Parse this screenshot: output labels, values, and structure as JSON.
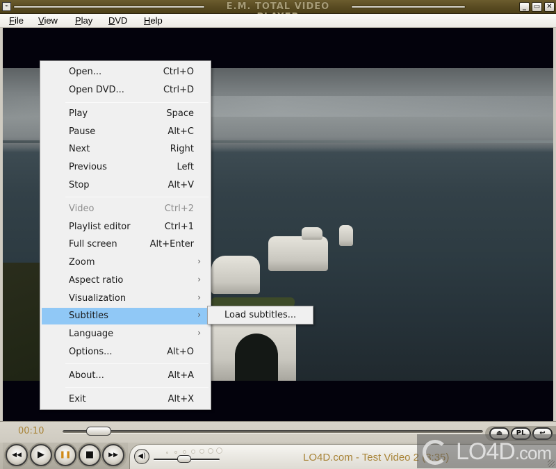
{
  "window": {
    "title": "E.M. TOTAL VIDEO PLAYER",
    "system_icon": "app-menu-icon",
    "buttons": {
      "minimize": "_",
      "maximize": "▭",
      "close": "✕"
    }
  },
  "menubar": {
    "items": [
      {
        "label": "File",
        "underline": "F",
        "rest": "ile"
      },
      {
        "label": "View",
        "underline": "V",
        "rest": "iew"
      },
      {
        "label": "Play",
        "underline": "P",
        "rest": "lay"
      },
      {
        "label": "DVD",
        "underline": "D",
        "rest": "VD"
      },
      {
        "label": "Help",
        "underline": "H",
        "rest": "elp"
      }
    ]
  },
  "context_menu": {
    "items": [
      {
        "label": "Open...",
        "shortcut": "Ctrl+O"
      },
      {
        "label": "Open DVD...",
        "shortcut": "Ctrl+D"
      },
      {
        "label": "Play",
        "shortcut": "Space"
      },
      {
        "label": "Pause",
        "shortcut": "Alt+C"
      },
      {
        "label": "Next",
        "shortcut": "Right"
      },
      {
        "label": "Previous",
        "shortcut": "Left"
      },
      {
        "label": "Stop",
        "shortcut": "Alt+V"
      },
      {
        "label": "Video",
        "shortcut": "Ctrl+2",
        "disabled": true
      },
      {
        "label": "Playlist editor",
        "shortcut": "Ctrl+1"
      },
      {
        "label": "Full screen",
        "shortcut": "Alt+Enter"
      },
      {
        "label": "Zoom",
        "submenu": true
      },
      {
        "label": "Aspect ratio",
        "submenu": true
      },
      {
        "label": "Visualization",
        "submenu": true
      },
      {
        "label": "Subtitles",
        "submenu": true,
        "highlighted": true
      },
      {
        "label": "Language",
        "submenu": true
      },
      {
        "label": "Options...",
        "shortcut": "Alt+O"
      },
      {
        "label": "About...",
        "shortcut": "Alt+A"
      },
      {
        "label": "Exit",
        "shortcut": "Alt+X"
      }
    ],
    "submenu_arrow": "›"
  },
  "submenu": {
    "items": [
      {
        "label": "Load subtitles..."
      }
    ]
  },
  "controls": {
    "elapsed_time": "00:10",
    "seek_progress_fraction": 0.06,
    "volume_fraction": 0.45,
    "right_buttons": {
      "eject": "⏏",
      "playlist": "PL",
      "repeat": "↩"
    },
    "transport": {
      "rewind": "◀◀",
      "play": "▶",
      "pause": "❚❚",
      "stop": "■",
      "forward": "▶▶"
    },
    "mute": "◀)",
    "now_playing": "LO4D.com - Test Video 2   (3:35)"
  },
  "watermark": {
    "brand": "LO4D",
    "suffix": ".com"
  },
  "colors": {
    "accent_gold": "#a88438",
    "menu_highlight": "#90c8f6",
    "title_bar": "#5a4c22"
  }
}
